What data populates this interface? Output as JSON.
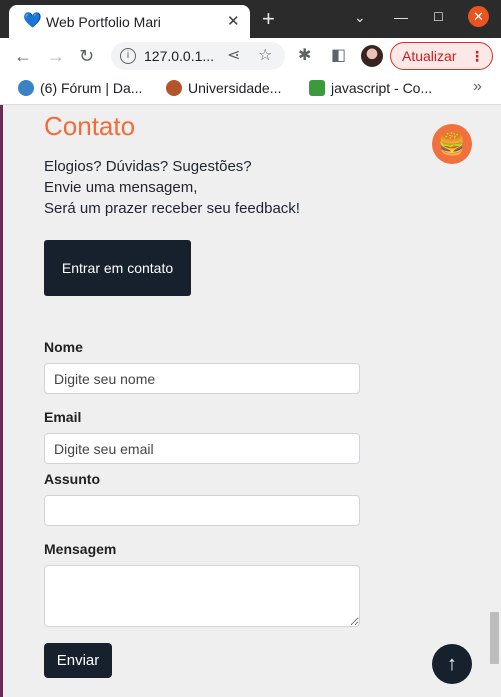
{
  "browser": {
    "tab_title": "Web Portfolio Mari",
    "url": "127.0.0.1...",
    "update_label": "Atualizar",
    "bookmarks": [
      {
        "label": "(6) Fórum | Da...",
        "color": "#3b82c4"
      },
      {
        "label": "Universidade...",
        "color": "#b5532a"
      },
      {
        "label": "javascript - Co...",
        "color": "#3c9a3c"
      }
    ]
  },
  "page": {
    "title": "Contato",
    "intro_lines": [
      "Elogios? Dúvidas? Sugestões?",
      "Envie uma mensagem,",
      "Será um prazer receber seu feedback!"
    ],
    "cta_label": "Entrar em contato",
    "form": {
      "name_label": "Nome",
      "name_placeholder": "Digite seu nome",
      "email_label": "Email",
      "email_placeholder": "Digite seu email",
      "subject_label": "Assunto",
      "subject_value": "",
      "message_label": "Mensagem",
      "message_value": "",
      "submit_label": "Enviar"
    }
  },
  "icons": {
    "theme_toggle": "hamburger-icon",
    "back_to_top": "arrow-up-icon"
  },
  "colors": {
    "accent": "#f26b3a",
    "button_dark": "#17212d"
  }
}
